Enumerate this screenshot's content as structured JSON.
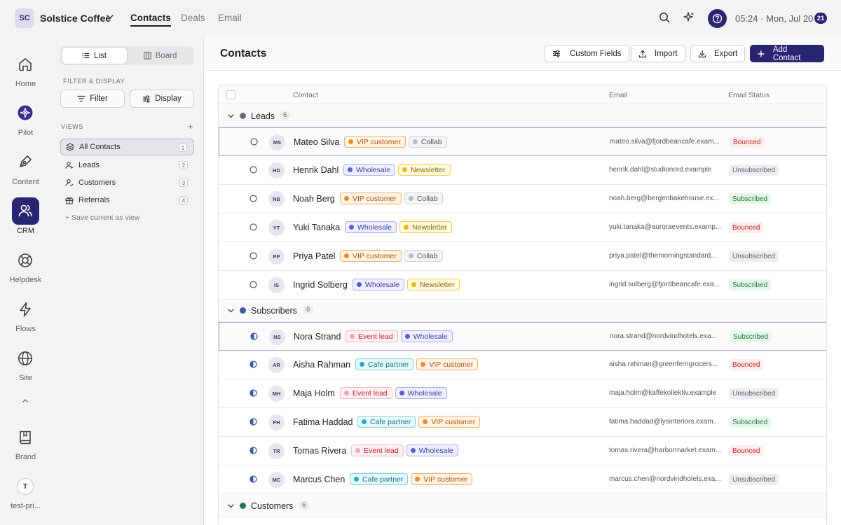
{
  "topbar": {
    "workspace_initials": "SC",
    "workspace_name": "Solstice Coffee",
    "tabs": [
      "Contacts",
      "Deals",
      "Email"
    ],
    "active_tab": "Contacts",
    "clock": "05:24 · Mon, Jul 20",
    "clock_badge": "21",
    "icons": [
      "search-icon",
      "sparkle-icon",
      "help-icon"
    ]
  },
  "rail": {
    "items": [
      {
        "label": "Home",
        "icon": "home-icon"
      },
      {
        "label": "Pilot",
        "icon": "pilot-icon"
      },
      {
        "label": "Content",
        "icon": "pen-icon"
      },
      {
        "label": "CRM",
        "icon": "users-icon",
        "active": true
      },
      {
        "label": "Helpdesk",
        "icon": "lifebuoy-icon"
      },
      {
        "label": "Flows",
        "icon": "bolt-icon"
      },
      {
        "label": "Site",
        "icon": "globe-icon"
      }
    ],
    "brand_label": "Brand",
    "user_initial": "T",
    "user_label": "test-pri..."
  },
  "panel": {
    "view_toggle": {
      "list": "List",
      "board": "Board",
      "active": "list"
    },
    "filter_heading": "FILTER & DISPLAY",
    "filter_label": "Filter",
    "display_label": "Display",
    "views_heading": "VIEWS",
    "views": [
      {
        "label": "All Contacts",
        "count": "1",
        "icon": "layers-icon",
        "active": true
      },
      {
        "label": "Leads",
        "count": "2",
        "icon": "user-plus-icon"
      },
      {
        "label": "Customers",
        "count": "3",
        "icon": "user-check-icon"
      },
      {
        "label": "Referrals",
        "count": "4",
        "icon": "gift-icon"
      }
    ],
    "save_view": "+ Save current as view"
  },
  "header": {
    "title": "Contacts",
    "buttons": {
      "custom_fields": "Custom Fields",
      "import": "Import",
      "export": "Export",
      "add_contact": "Add Contact"
    }
  },
  "table": {
    "columns": {
      "contact": "Contact",
      "email": "Email",
      "email_status": "Email Status"
    },
    "groups": [
      {
        "name": "Leads",
        "count": "6",
        "color": "#6b6b72",
        "status_icon": "circle-outline"
      },
      {
        "name": "Subscribers",
        "count": "6",
        "color": "#3b5aa6",
        "status_icon": "circle-half"
      },
      {
        "name": "Customers",
        "count": "6",
        "color": "#1f7a4a",
        "status_icon": "circle-filled"
      }
    ],
    "rows": [
      {
        "initials": "MS",
        "name": "Mateo Silva",
        "tags": [
          "VIP customer",
          "Collab"
        ],
        "email": "mateo.silva@fjordbeancafe.exam...",
        "status": "Bounced",
        "selected": true
      },
      {
        "initials": "HD",
        "name": "Henrik Dahl",
        "tags": [
          "Wholesale",
          "Newsletter"
        ],
        "email": "henrik.dahl@studionord.example",
        "status": "Unsubscribed"
      },
      {
        "initials": "NB",
        "name": "Noah Berg",
        "tags": [
          "VIP customer",
          "Collab"
        ],
        "email": "noah.berg@bergenbakehouse.ex...",
        "status": "Subscribed"
      },
      {
        "initials": "YT",
        "name": "Yuki Tanaka",
        "tags": [
          "Wholesale",
          "Newsletter"
        ],
        "email": "yuki.tanaka@auroraevents.examp...",
        "status": "Bounced"
      },
      {
        "initials": "PP",
        "name": "Priya Patel",
        "tags": [
          "VIP customer",
          "Collab"
        ],
        "email": "priya.patel@themorningstandard...",
        "status": "Unsubscribed"
      },
      {
        "initials": "IS",
        "name": "Ingrid Solberg",
        "tags": [
          "Wholesale",
          "Newsletter"
        ],
        "email": "ingrid.solberg@fjordbeancafe.exa...",
        "status": "Subscribed"
      },
      {
        "initials": "NS",
        "name": "Nora Strand",
        "tags": [
          "Event lead",
          "Wholesale"
        ],
        "email": "nora.strand@nordvindhotels.exa...",
        "status": "Subscribed",
        "selected": true
      },
      {
        "initials": "AR",
        "name": "Aisha Rahman",
        "tags": [
          "Cafe partner",
          "VIP customer"
        ],
        "email": "aisha.rahman@greenferngrocers...",
        "status": "Bounced"
      },
      {
        "initials": "MH",
        "name": "Maja Holm",
        "tags": [
          "Event lead",
          "Wholesale"
        ],
        "email": "maja.holm@kaffekollektiv.example",
        "status": "Unsubscribed"
      },
      {
        "initials": "FH",
        "name": "Fatima Haddad",
        "tags": [
          "Cafe partner",
          "VIP customer"
        ],
        "email": "fatima.haddad@lysinteriors.exam...",
        "status": "Subscribed"
      },
      {
        "initials": "TR",
        "name": "Tomas Rivera",
        "tags": [
          "Event lead",
          "Wholesale"
        ],
        "email": "tomas.rivera@harbormarket.exam...",
        "status": "Bounced"
      },
      {
        "initials": "MC",
        "name": "Marcus Chen",
        "tags": [
          "Cafe partner",
          "VIP customer"
        ],
        "email": "marcus.chen@nordvindhotels.exa...",
        "status": "Unsubscribed"
      }
    ]
  },
  "tag_colors": {
    "VIP customer": {
      "dot": "#f08a24",
      "bg": "#fff3e6",
      "border": "#f4b26a",
      "text": "#b4530a"
    },
    "Collab": {
      "dot": "#b9bcc4",
      "bg": "#f4f5f7",
      "border": "#d3d5db",
      "text": "#4d5058"
    },
    "Wholesale": {
      "dot": "#5a5fd6",
      "bg": "#eef0ff",
      "border": "#a9aef0",
      "text": "#3b40b0"
    },
    "Newsletter": {
      "dot": "#e8b80c",
      "bg": "#fff9e0",
      "border": "#f0cf4a",
      "text": "#8a6a00"
    },
    "Event lead": {
      "dot": "#f4a5b1",
      "bg": "#fff0f2",
      "border": "#f4b8c1",
      "text": "#c2253d"
    },
    "Cafe partner": {
      "dot": "#1fb3c1",
      "bg": "#e8f9fb",
      "border": "#7fd3dc",
      "text": "#117a85"
    }
  },
  "status_colors": {
    "Bounced": {
      "bg": "#fdecec",
      "text": "#c62828"
    },
    "Unsubscribed": {
      "bg": "#eeeef0",
      "text": "#5f6066"
    },
    "Subscribed": {
      "bg": "#e6f6ea",
      "text": "#1f7a3a"
    }
  }
}
